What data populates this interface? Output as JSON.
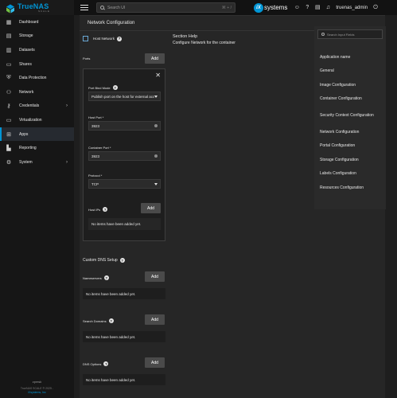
{
  "brand": {
    "title": "TrueNAS",
    "subtitle": "SCALE"
  },
  "search": {
    "placeholder": "Search UI",
    "shortcut": "⌘ + /"
  },
  "header": {
    "company": "systems",
    "username": "truenas_admin"
  },
  "sidebar": {
    "items": [
      {
        "label": "Dashboard",
        "icon": "dashboard-icon"
      },
      {
        "label": "Storage",
        "icon": "storage-icon"
      },
      {
        "label": "Datasets",
        "icon": "datasets-icon"
      },
      {
        "label": "Shares",
        "icon": "folder-icon"
      },
      {
        "label": "Data Protection",
        "icon": "shield-icon"
      },
      {
        "label": "Network",
        "icon": "network-icon"
      },
      {
        "label": "Credentials",
        "icon": "key-icon"
      },
      {
        "label": "Virtualization",
        "icon": "monitor-icon"
      },
      {
        "label": "Apps",
        "icon": "apps-icon"
      },
      {
        "label": "Reporting",
        "icon": "chart-icon"
      },
      {
        "label": "System",
        "icon": "gear-icon"
      }
    ],
    "hostname": "zpmsk",
    "copyright": "TrueNAS SCALE ® 2025 -",
    "company": "iXsystems, Inc"
  },
  "main": {
    "title": "Network Configuration",
    "host_network_label": "Host Network",
    "section_help_title": "Section Help",
    "section_help_text": "Configure Network for the container",
    "ports_label": "Ports",
    "add_label": "Add",
    "port_bind_mode_label": "Port Bind Mode",
    "port_bind_mode_value": "Publish port on the host for external access",
    "host_port_label": "Host Port *",
    "host_port_value": "3923",
    "container_port_label": "Container Port *",
    "container_port_value": "3923",
    "protocol_label": "Protocol *",
    "protocol_value": "TCP",
    "host_ips_label": "Host IPs",
    "empty_text": "No items have been added yet.",
    "custom_dns_label": "Custom DNS Setup",
    "nameservers_label": "Nameservers",
    "search_domains_label": "Search Domains",
    "dns_options_label": "DNS Options"
  },
  "index": {
    "search_placeholder": "Search Input Fields",
    "items": [
      "Application name",
      "General",
      "Image Configuration",
      "Container Configuration",
      "Security Context Configuration",
      "Network Configuration",
      "Portal Configuration",
      "Storage Configuration",
      "Labels Configuration",
      "Resources Configuration"
    ]
  },
  "colors": {
    "accent": "#0095d5",
    "background": "#1e1e1e",
    "panel": "#262626"
  }
}
